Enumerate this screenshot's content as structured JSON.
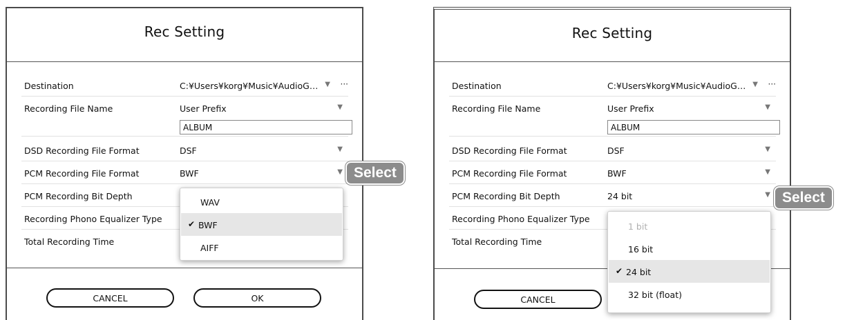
{
  "dialog1": {
    "title": "Rec Setting",
    "rows": [
      {
        "label": "Destination",
        "value": "C:¥Users¥korg¥Music¥AudioG…",
        "arrow": "▼",
        "more": "···"
      },
      {
        "label": "Recording File Name",
        "value": "User Prefix",
        "arrow": "▼",
        "field_value": "ALBUM"
      },
      {
        "label": "DSD Recording File Format",
        "value": "DSF",
        "arrow": "▼"
      },
      {
        "label": "PCM Recording File Format",
        "value": "BWF",
        "arrow": "▼"
      },
      {
        "label": "PCM Recording Bit Depth"
      },
      {
        "label": "Recording Phono Equalizer Type"
      },
      {
        "label": "Total Recording Time"
      }
    ],
    "cancel_label": "CANCEL",
    "ok_label": "OK",
    "menu": {
      "items": [
        {
          "label": "WAV",
          "selected": false
        },
        {
          "label": "BWF",
          "selected": true
        },
        {
          "label": "AIFF",
          "selected": false
        }
      ]
    },
    "badge": "Select"
  },
  "dialog2": {
    "title": "Rec Setting",
    "rows": [
      {
        "label": "Destination",
        "value": "C:¥Users¥korg¥Music¥AudioG…",
        "arrow": "▼",
        "more": "···"
      },
      {
        "label": "Recording File Name",
        "value": "User Prefix",
        "arrow": "▼",
        "field_value": "ALBUM"
      },
      {
        "label": "DSD Recording File Format",
        "value": "DSF",
        "arrow": "▼"
      },
      {
        "label": "PCM Recording File Format",
        "value": "BWF",
        "arrow": "▼"
      },
      {
        "label": "PCM Recording Bit Depth",
        "value": "24 bit",
        "arrow": "▼"
      },
      {
        "label": "Recording Phono Equalizer Type"
      },
      {
        "label": "Total Recording Time"
      }
    ],
    "cancel_label": "CANCEL",
    "menu": {
      "items": [
        {
          "label": "1 bit",
          "selected": false,
          "disabled": true
        },
        {
          "label": "16 bit",
          "selected": false
        },
        {
          "label": "24 bit",
          "selected": true
        },
        {
          "label": "32 bit (float)",
          "selected": false
        }
      ]
    },
    "badge": "Select"
  },
  "icons": {
    "checkmark": "✔"
  },
  "colors": {
    "badge": "#8c8c8c",
    "selected_item": "#e6e6e6",
    "frame": "#4a4a4a"
  }
}
